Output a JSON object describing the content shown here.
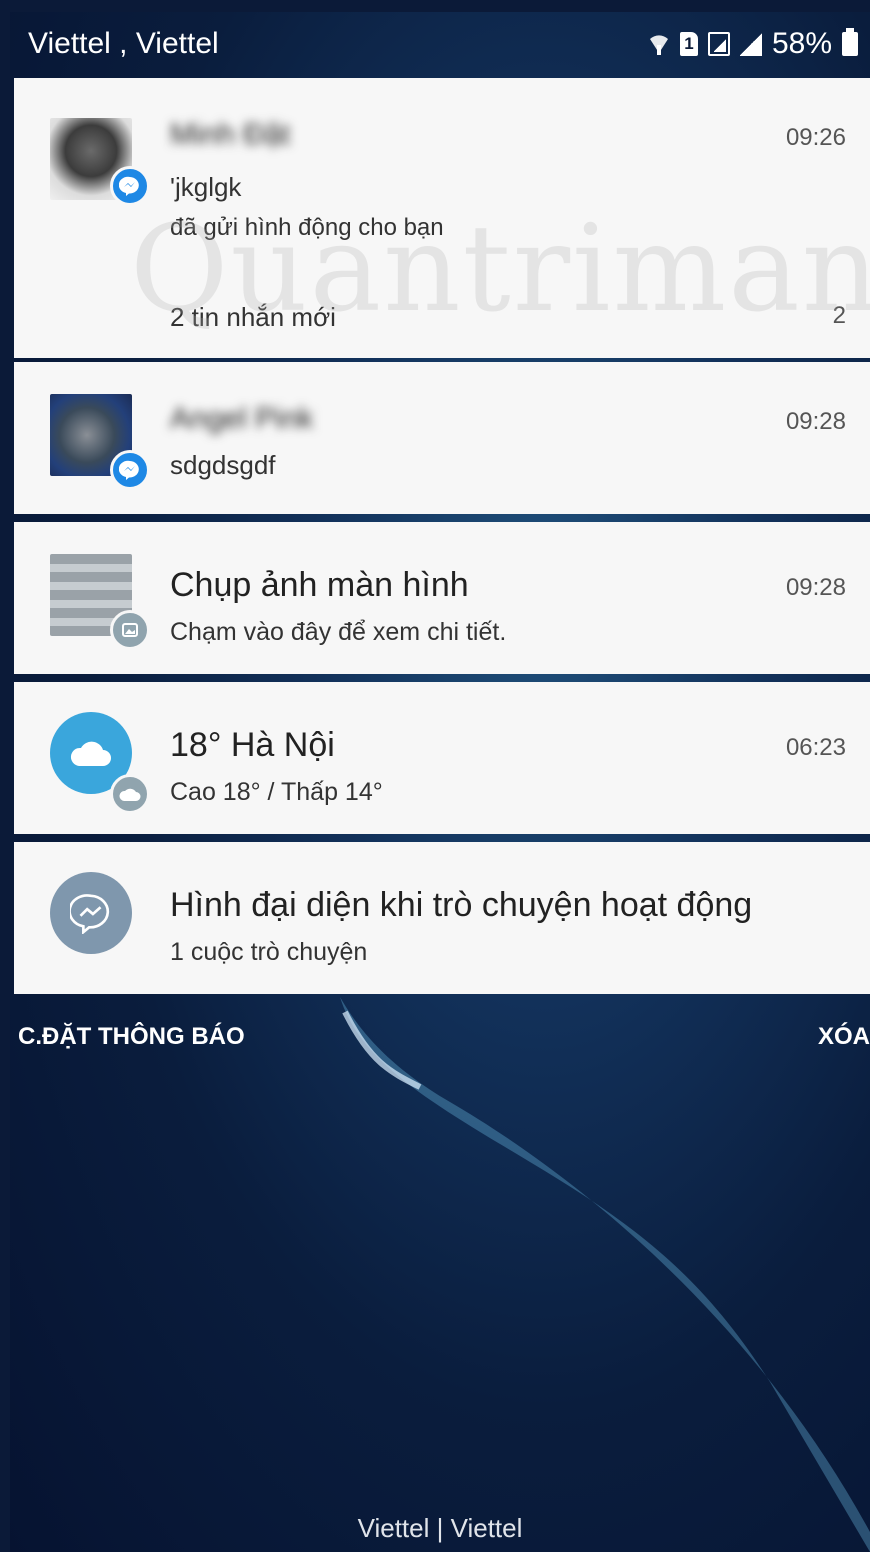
{
  "status_bar": {
    "carrier": "Viettel , Viettel",
    "battery": "58%"
  },
  "watermark": "Quantrimang",
  "notifications": [
    {
      "sender": "Minh Đặt",
      "time": "09:26",
      "line1": "'jkglgk",
      "line2": "đã gửi hình động cho bạn",
      "summary": "2 tin nhắn mới",
      "count": "2",
      "app_badge": "messenger-icon"
    },
    {
      "sender": "Angel Pink",
      "time": "09:28",
      "line1": "sdgdsgdf",
      "app_badge": "messenger-icon"
    },
    {
      "title": "Chụp ảnh màn hình",
      "time": "09:28",
      "subtitle": "Chạm vào đây để xem chi tiết.",
      "app_badge": "gallery-icon"
    },
    {
      "title": "18° Hà Nội",
      "time": "06:23",
      "subtitle": "Cao 18° / Thấp 14°",
      "app_badge": "weather-icon"
    },
    {
      "title": "Hình đại diện khi trò chuyện hoạt động",
      "subtitle": "1 cuộc trò chuyện",
      "app_badge": "messenger-icon"
    }
  ],
  "actions": {
    "settings": "C.ĐẶT THÔNG BÁO",
    "clear": "XÓA"
  },
  "footer": "Viettel | Viettel",
  "colors": {
    "card_bg": "#f7f7f7",
    "messenger_blue": "#1e88e5",
    "weather_blue": "#3aa6dc",
    "chathead_gray": "#7f97ad",
    "background_navy": "#0a1d3d"
  }
}
